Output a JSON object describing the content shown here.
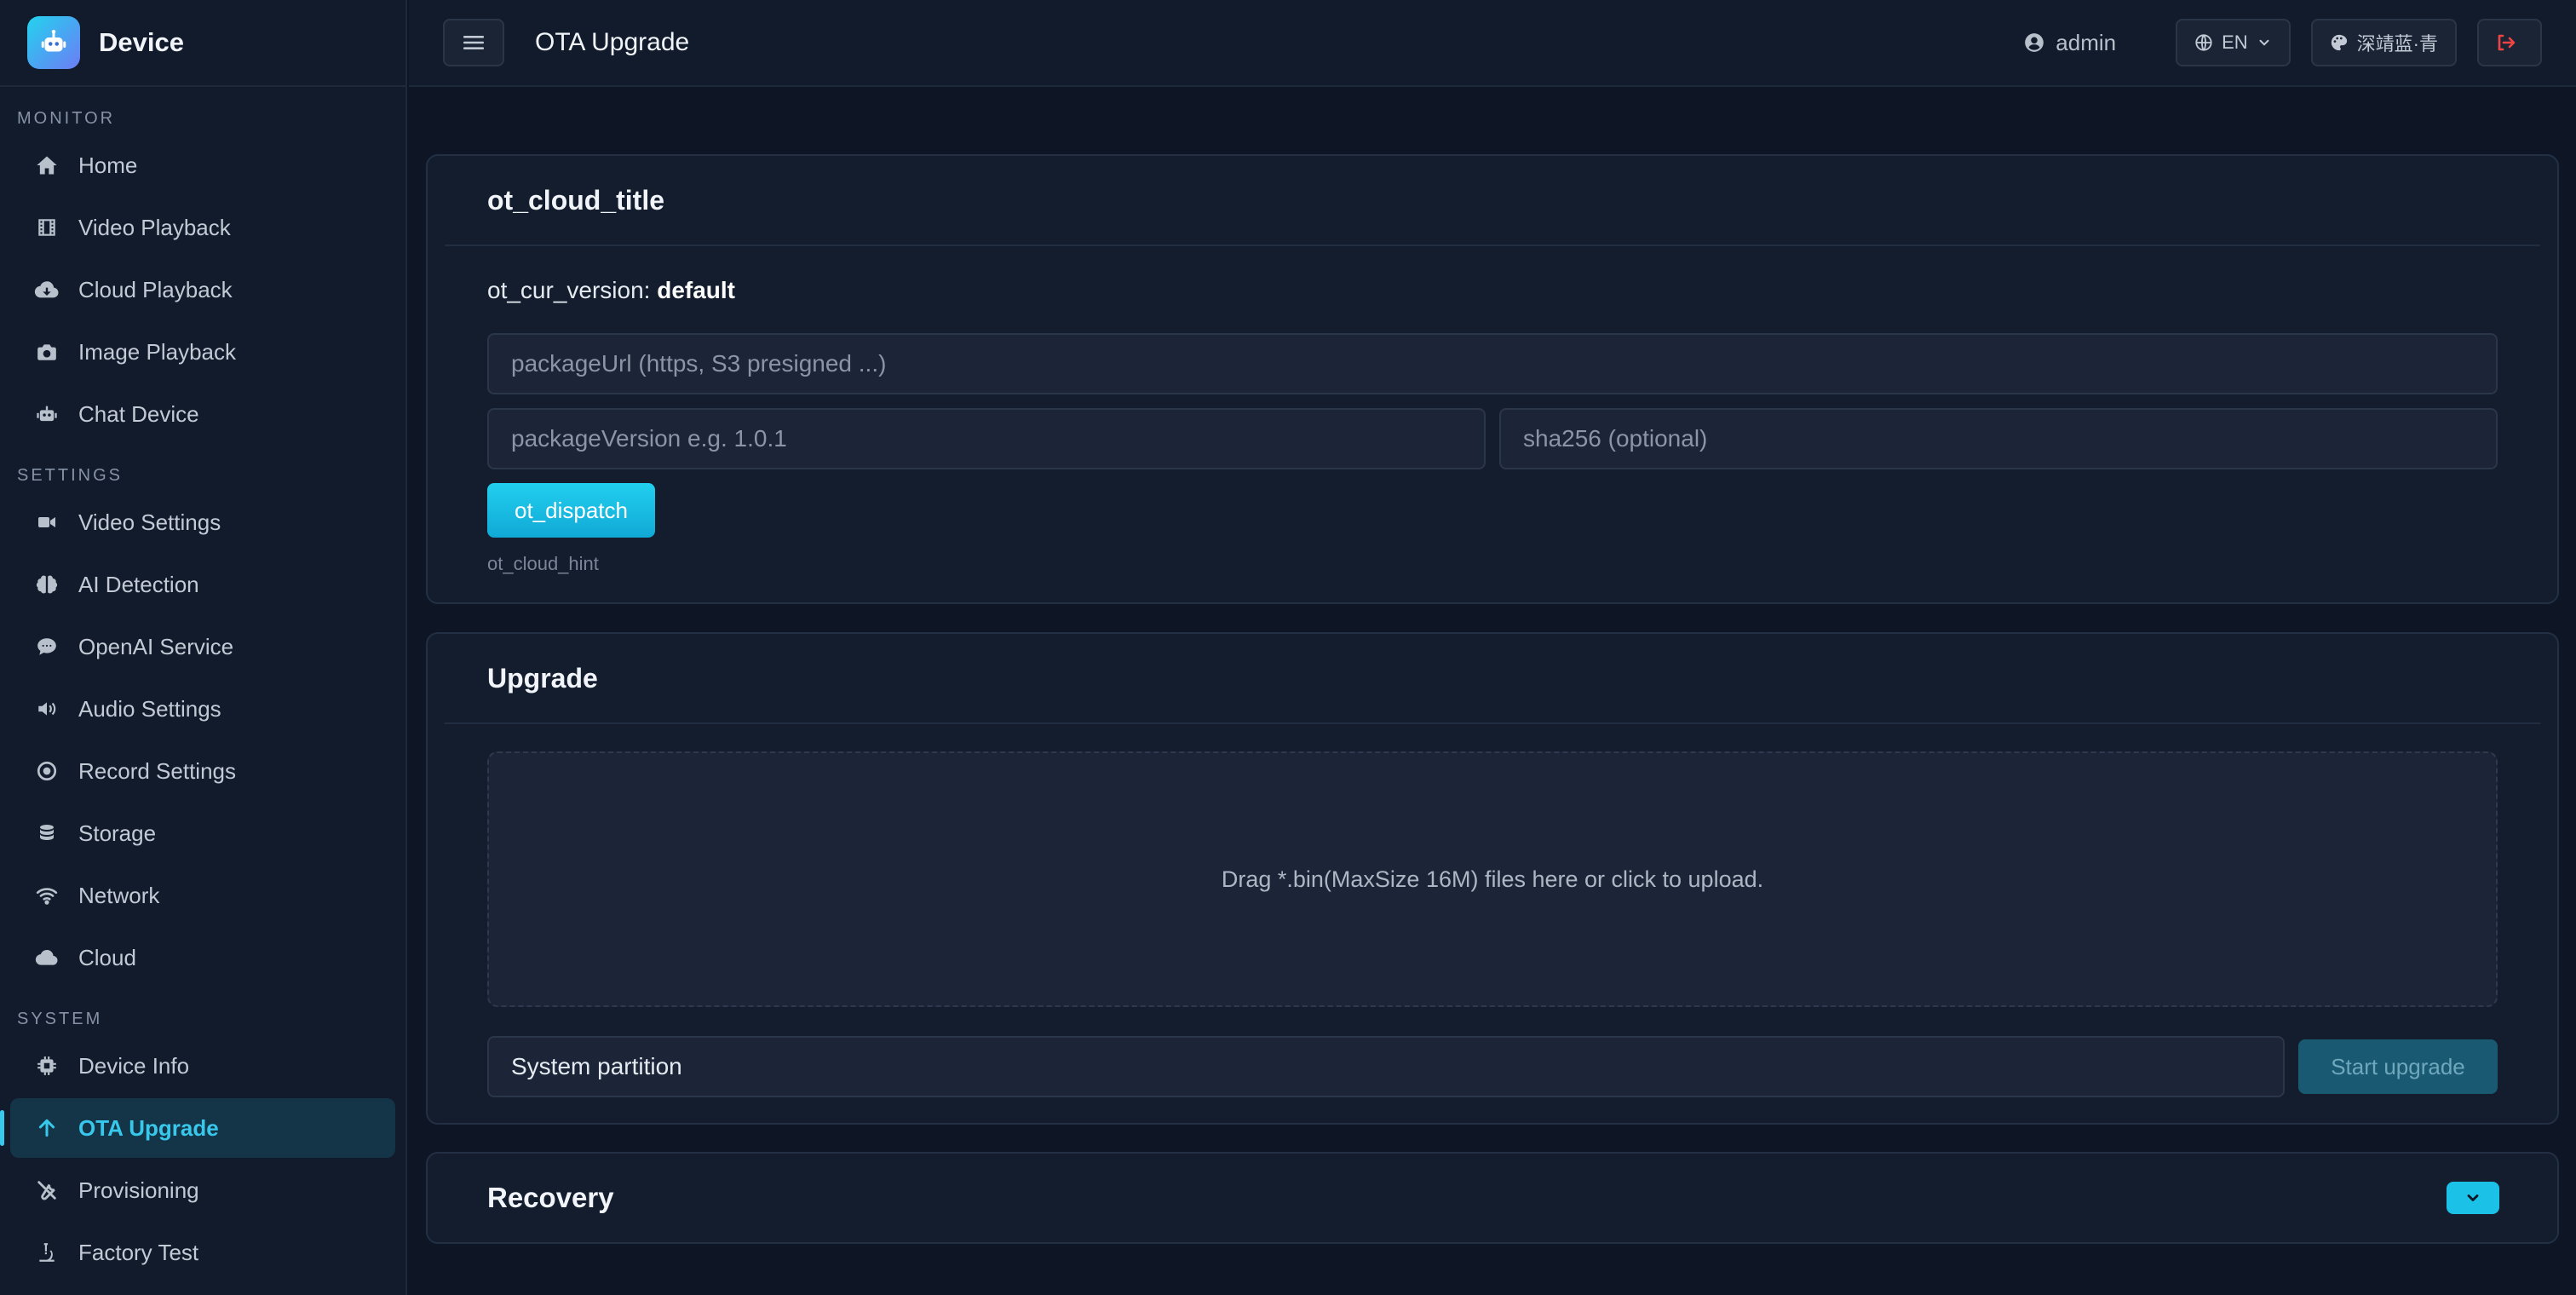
{
  "app": {
    "name": "Device"
  },
  "sidebar": {
    "sections": [
      {
        "label": "MONITOR",
        "items": [
          {
            "label": "Home",
            "icon": "home-icon"
          },
          {
            "label": "Video Playback",
            "icon": "film-icon"
          },
          {
            "label": "Cloud Playback",
            "icon": "cloud-download-icon"
          },
          {
            "label": "Image Playback",
            "icon": "camera-icon"
          },
          {
            "label": "Chat Device",
            "icon": "robot-icon"
          }
        ]
      },
      {
        "label": "SETTINGS",
        "items": [
          {
            "label": "Video Settings",
            "icon": "video-icon"
          },
          {
            "label": "AI Detection",
            "icon": "brain-icon"
          },
          {
            "label": "OpenAI Service",
            "icon": "chat-icon"
          },
          {
            "label": "Audio Settings",
            "icon": "speaker-icon"
          },
          {
            "label": "Record Settings",
            "icon": "record-icon"
          },
          {
            "label": "Storage",
            "icon": "database-icon"
          },
          {
            "label": "Network",
            "icon": "wifi-icon"
          },
          {
            "label": "Cloud",
            "icon": "cloud-icon"
          }
        ]
      },
      {
        "label": "SYSTEM",
        "items": [
          {
            "label": "Device Info",
            "icon": "chip-icon"
          },
          {
            "label": "OTA Upgrade",
            "icon": "arrow-up-icon",
            "active": true
          },
          {
            "label": "Provisioning",
            "icon": "tools-icon"
          },
          {
            "label": "Factory Test",
            "icon": "microscope-icon"
          }
        ]
      }
    ]
  },
  "header": {
    "title": "OTA Upgrade",
    "user": "admin",
    "language": "EN",
    "theme": "深靖蓝·青"
  },
  "cloud_card": {
    "title": "ot_cloud_title",
    "version_label": "ot_cur_version:",
    "version_value": "default",
    "package_url_placeholder": "packageUrl (https, S3 presigned ...)",
    "package_version_placeholder": "packageVersion e.g. 1.0.1",
    "sha256_placeholder": "sha256 (optional)",
    "dispatch_label": "ot_dispatch",
    "hint": "ot_cloud_hint"
  },
  "upgrade_card": {
    "title": "Upgrade",
    "dropzone_text": "Drag *.bin(MaxSize 16M) files here or click to upload.",
    "partition_value": "System partition",
    "start_label": "Start upgrade"
  },
  "recovery_card": {
    "title": "Recovery"
  },
  "colors": {
    "accent": "#38c8ec",
    "background": "#0e1626",
    "card": "#131d2e",
    "logout": "#ef4444"
  }
}
